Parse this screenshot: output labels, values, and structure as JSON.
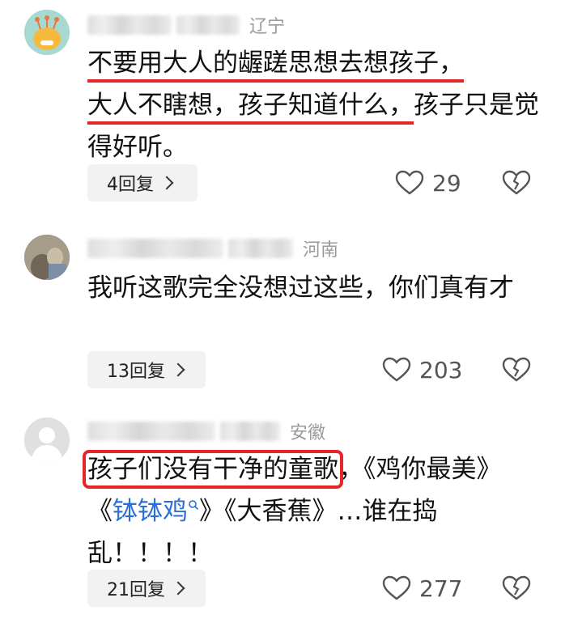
{
  "comments": [
    {
      "location": "辽宁",
      "text_part1": "不要用大人的龌蹉思想去想孩子，",
      "text_part2": "大人不瞎想，孩子知道什么，",
      "text_part3": "孩子只是觉得好听。",
      "replies_label": "4回复",
      "likes": "29"
    },
    {
      "location": "河南",
      "text": "我听这歌完全没想过这些，你们真有才",
      "replies_label": "13回复",
      "likes": "203"
    },
    {
      "location": "安徽",
      "text_highlight": "孩子们没有干净的童歌",
      "text_comma": "，",
      "text_part_a": "《鸡你最美》《",
      "text_link": "钵钵鸡",
      "text_part_b": "》《大香蕉》…谁在捣乱！！！！",
      "replies_label": "21回复",
      "likes": "277"
    }
  ],
  "colors": {
    "highlight": "#e5252a",
    "link": "#2a6fd6",
    "location": "#9a9a9a"
  }
}
